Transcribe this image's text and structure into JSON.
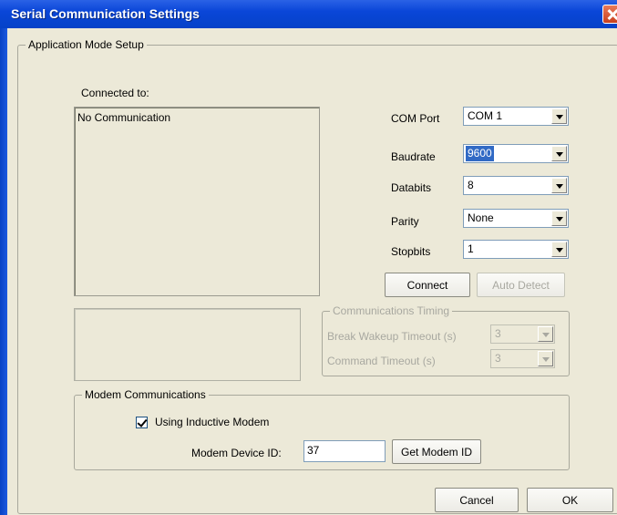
{
  "window": {
    "title": "Serial Communication Settings"
  },
  "app_mode": {
    "legend": "Application Mode Setup",
    "connected_label": "Connected to:",
    "connected_value": "No Communication"
  },
  "serial": {
    "com_port": {
      "label": "COM Port",
      "value": "COM 1"
    },
    "baudrate": {
      "label": "Baudrate",
      "value": "9600"
    },
    "databits": {
      "label": "Databits",
      "value": "8"
    },
    "parity": {
      "label": "Parity",
      "value": "None"
    },
    "stopbits": {
      "label": "Stopbits",
      "value": "1"
    }
  },
  "buttons": {
    "connect": "Connect",
    "auto_detect": "Auto Detect",
    "get_modem_id": "Get Modem ID",
    "cancel": "Cancel",
    "ok": "OK"
  },
  "timing": {
    "legend": "Communications Timing",
    "break_wakeup_label": "Break Wakeup Timeout (s)",
    "break_wakeup_value": "3",
    "command_timeout_label": "Command Timeout (s)",
    "command_timeout_value": "3"
  },
  "modem": {
    "legend": "Modem Communications",
    "checkbox_label": "Using Inductive Modem",
    "checked": true,
    "device_id_label": "Modem Device ID:",
    "device_id_value": "37"
  }
}
